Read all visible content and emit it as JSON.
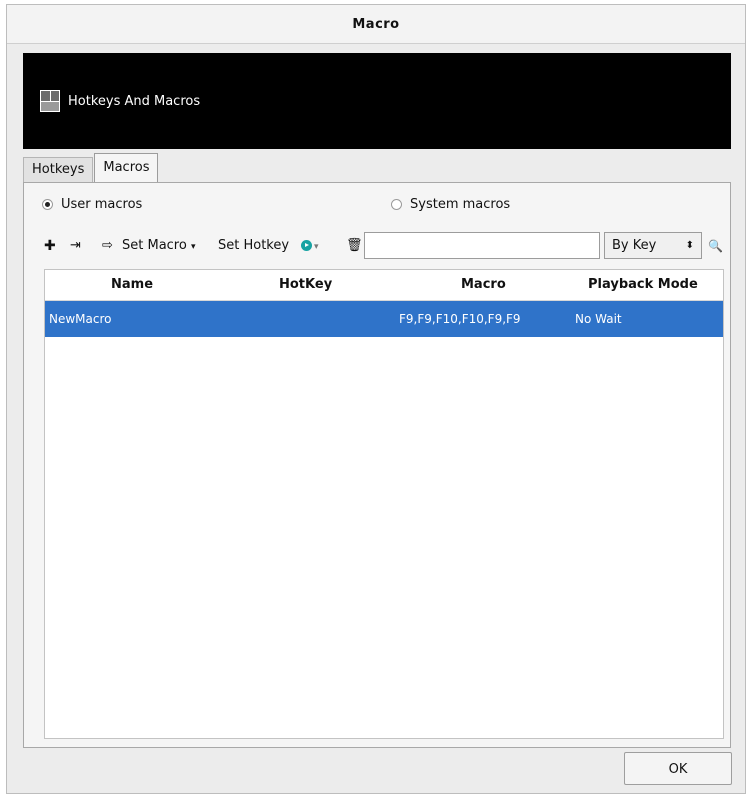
{
  "window": {
    "title": "Macro"
  },
  "banner": {
    "title": "Hotkeys And Macros"
  },
  "tabs": [
    {
      "label": "Hotkeys"
    },
    {
      "label": "Macros"
    }
  ],
  "radios": {
    "user_label": "User macros",
    "system_label": "System macros",
    "selected": "user"
  },
  "toolbar": {
    "set_macro_label": "Set Macro",
    "set_hotkey_label": "Set Hotkey",
    "search_placeholder": "",
    "filter_value": "By Key"
  },
  "table": {
    "headers": {
      "name": "Name",
      "hotkey": "HotKey",
      "macro": "Macro",
      "playback": "Playback Mode"
    },
    "rows": [
      {
        "name": "NewMacro",
        "hotkey": "",
        "macro": "F9,F9,F10,F10,F9,F9",
        "playback": "No Wait",
        "selected": true
      }
    ]
  },
  "buttons": {
    "ok_label": "OK"
  },
  "colors": {
    "selection": "#2f73c9",
    "banner": "#000000",
    "play_icon": "#17a3a3"
  }
}
